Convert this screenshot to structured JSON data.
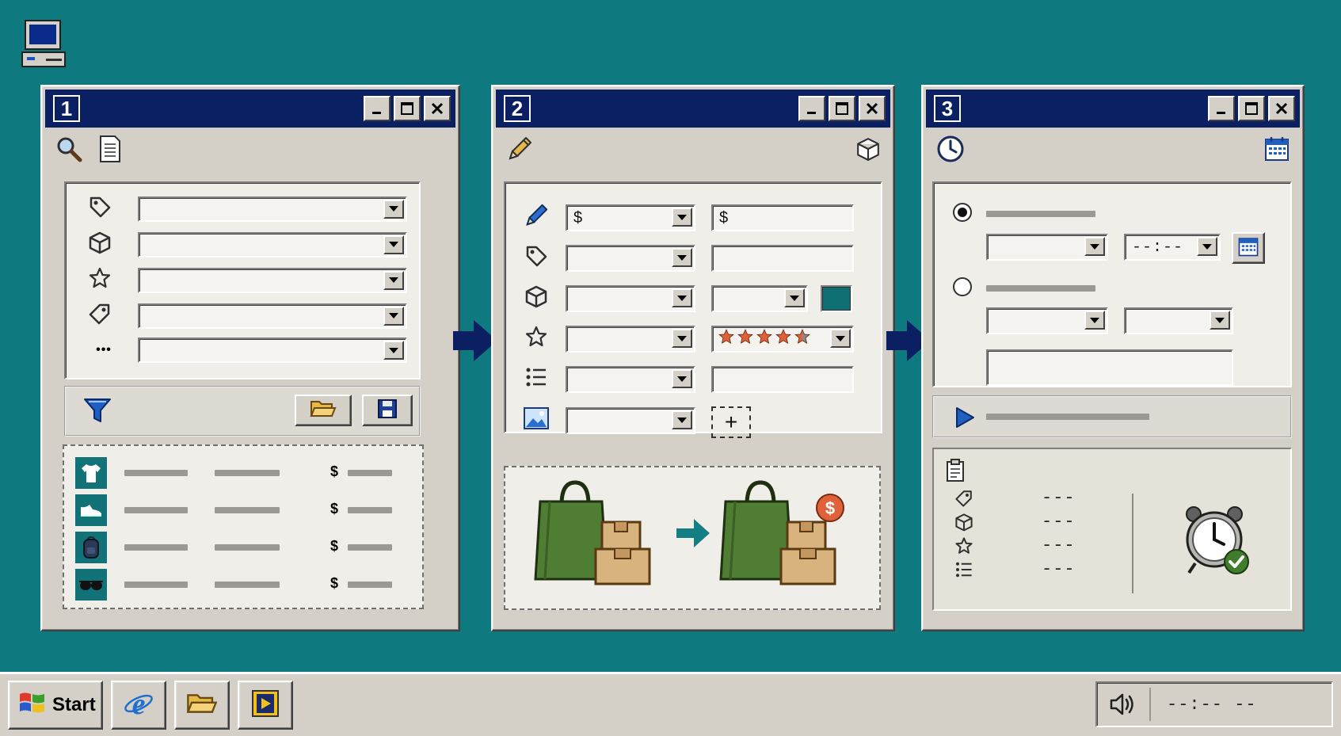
{
  "colors": {
    "desktop": "#0e7a80",
    "titlebar": "#0b1f63",
    "chrome": "#d4d0c8",
    "panel": "#efeee9",
    "accent_teal": "#0e7a80",
    "swatch": "#0e6f73",
    "star_orange": "#e0623a",
    "bag_green": "#4e7d33"
  },
  "desktop_icon": "computer-icon",
  "window1": {
    "number": "1",
    "toolbar_icons": [
      "search-icon",
      "document-icon"
    ],
    "filters": [
      {
        "icon": "tag-icon"
      },
      {
        "icon": "box-icon"
      },
      {
        "icon": "star-icon"
      },
      {
        "icon": "tag-icon"
      },
      {
        "icon": "more-icon",
        "symbol": "•••"
      }
    ],
    "action_icons": [
      "funnel-icon",
      "folder-open-icon",
      "save-icon"
    ],
    "list": [
      {
        "icon": "tshirt-icon",
        "currency": "$"
      },
      {
        "icon": "shoe-icon",
        "currency": "$"
      },
      {
        "icon": "backpack-icon",
        "currency": "$"
      },
      {
        "icon": "sunglasses-icon",
        "currency": "$"
      }
    ]
  },
  "window2": {
    "number": "2",
    "toolbar_icons": [
      "pencil-icon",
      "box-icon"
    ],
    "rows": [
      {
        "icon": "pencil-icon",
        "combo_prefix": "$",
        "field_prefix": "$"
      },
      {
        "icon": "tag-icon",
        "combo_prefix": "",
        "field_prefix": ""
      },
      {
        "icon": "box-icon",
        "combo_prefix": "",
        "field_prefix": ""
      },
      {
        "icon": "star-icon",
        "combo_prefix": "",
        "field_prefix": ""
      },
      {
        "icon": "list-icon",
        "combo_prefix": "",
        "field_prefix": ""
      },
      {
        "icon": "image-icon",
        "combo_prefix": "",
        "field_prefix": ""
      }
    ],
    "rating_stars": 4.5,
    "add_symbol": "+"
  },
  "window3": {
    "number": "3",
    "toolbar_icons": [
      "clock-icon",
      "calendar-icon"
    ],
    "time_placeholder": "--:--",
    "summary_icons": [
      "clipboard-icon",
      "tag-icon",
      "box-icon",
      "star-icon",
      "list-icon"
    ],
    "summary_values": [
      "---",
      "---",
      "---",
      "---"
    ]
  },
  "taskbar": {
    "start_label": "Start",
    "apps": [
      "browser-icon",
      "folder-icon",
      "media-player-icon"
    ],
    "clock": "--:-- --"
  }
}
